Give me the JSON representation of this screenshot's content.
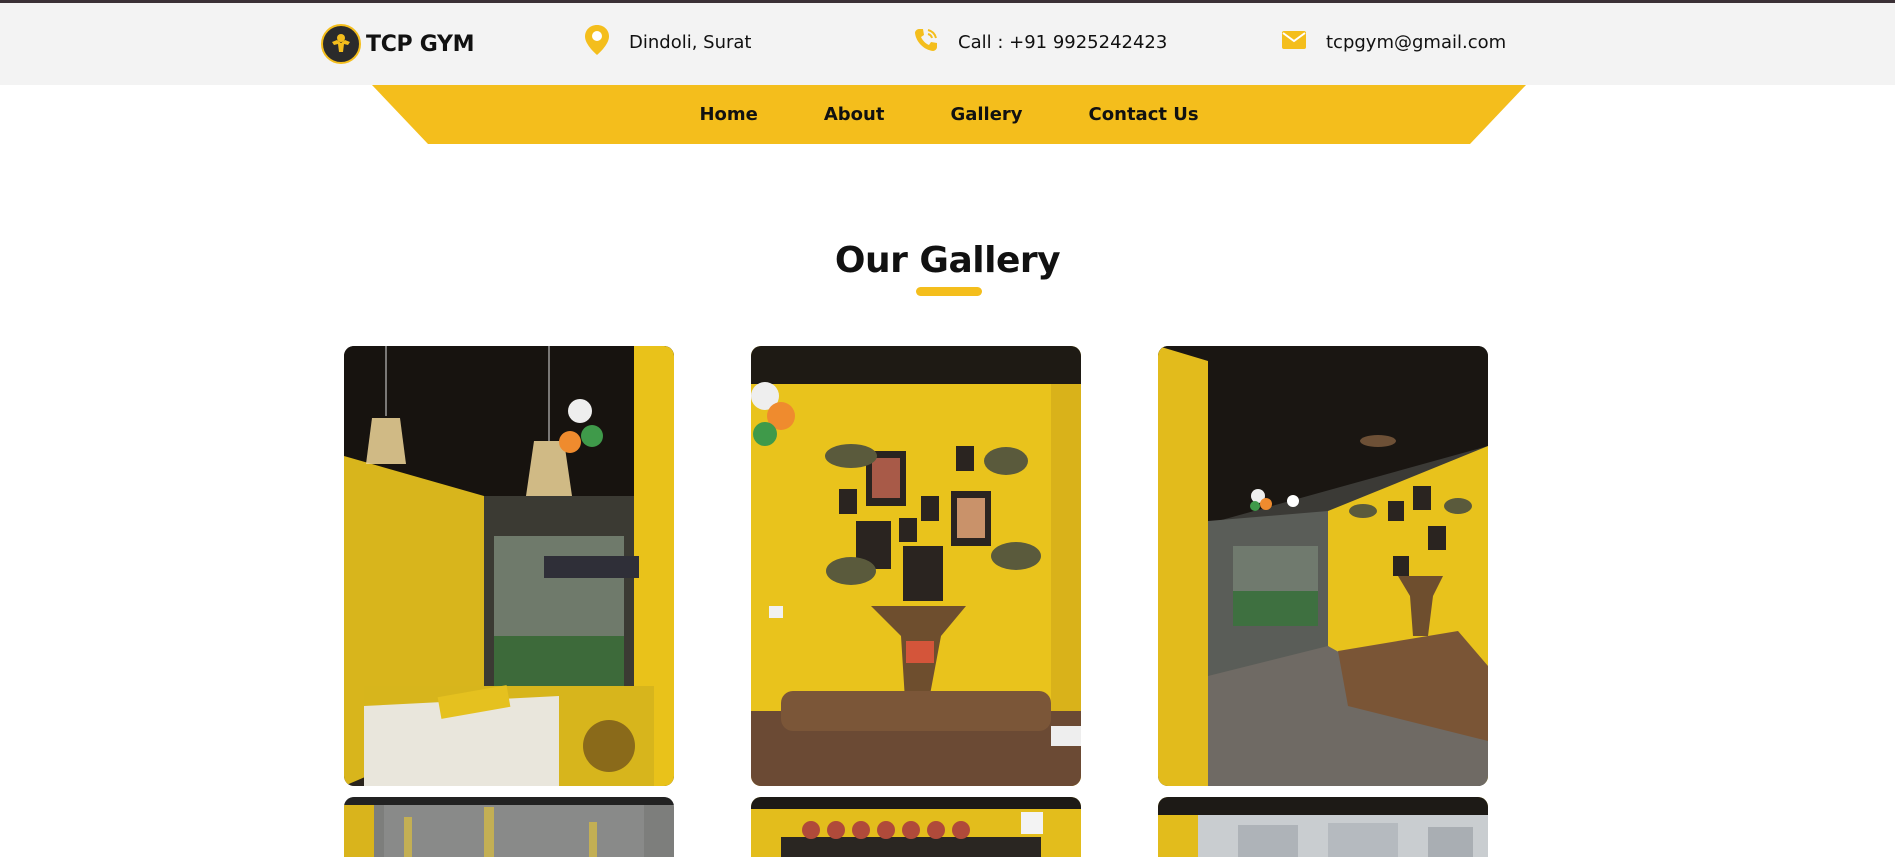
{
  "header": {
    "brand": "TCP GYM",
    "location": "Dindoli, Surat",
    "phone": "Call : +91 9925242423",
    "email": "tcpgym@gmail.com"
  },
  "nav": {
    "items": [
      "Home",
      "About",
      "Gallery",
      "Contact Us"
    ]
  },
  "gallery": {
    "title": "Our Gallery"
  },
  "colors": {
    "accent": "#f4be1c",
    "topbar": "#f3f3f3",
    "text": "#111111"
  },
  "icons": [
    "dumbbell-logo-icon",
    "map-pin-icon",
    "phone-icon",
    "mail-icon"
  ]
}
